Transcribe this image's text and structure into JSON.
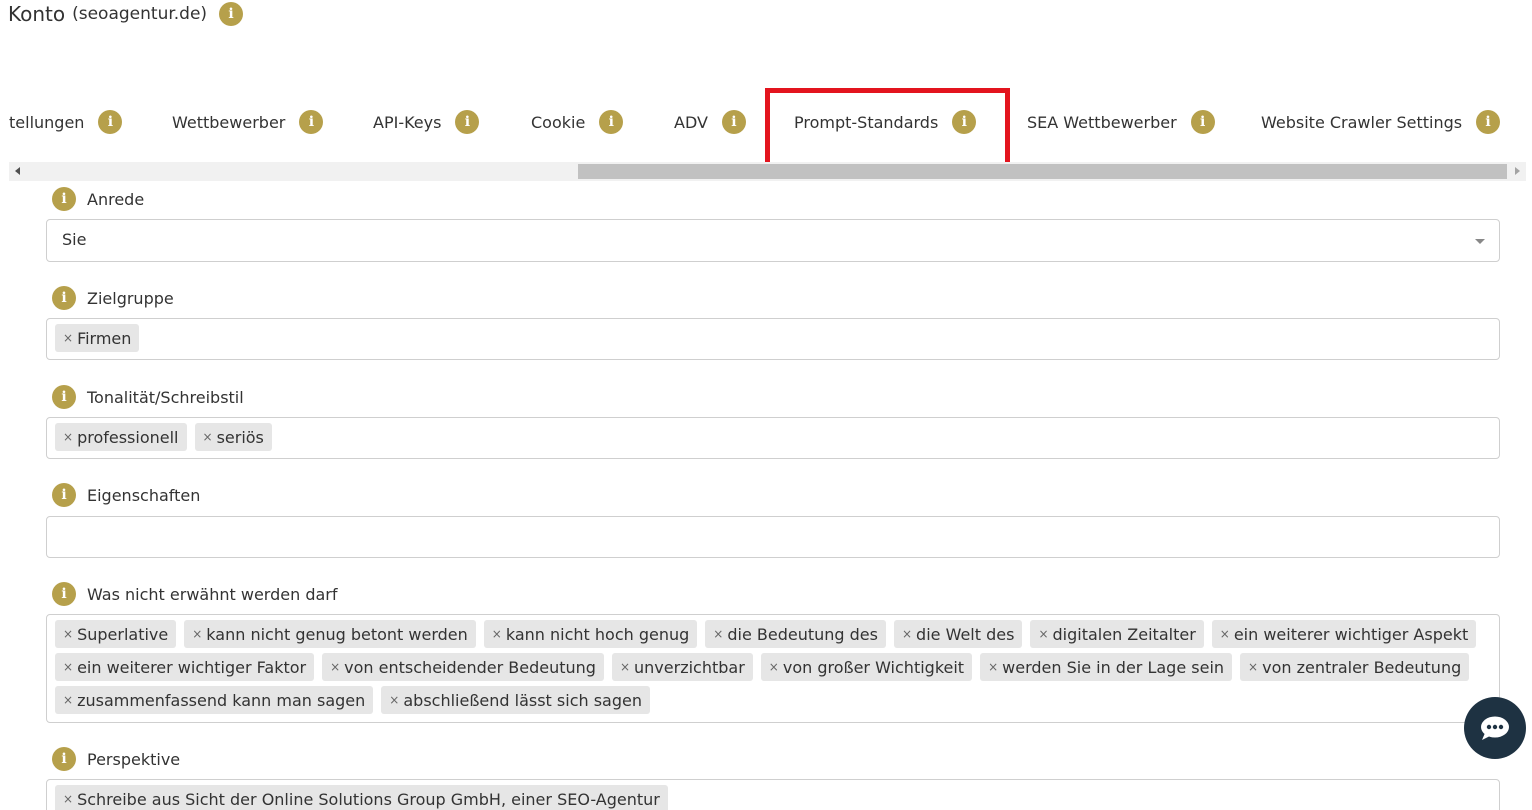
{
  "header": {
    "title": "Konto",
    "subtitle": "(seoagentur.de)",
    "info_icon": "i"
  },
  "tabs": [
    {
      "label": "tellungen",
      "icon": "i"
    },
    {
      "label": "Wettbewerber",
      "icon": "i"
    },
    {
      "label": "API-Keys",
      "icon": "i"
    },
    {
      "label": "Cookie",
      "icon": "i"
    },
    {
      "label": "ADV",
      "icon": "i"
    },
    {
      "label": "Prompt-Standards",
      "icon": "i"
    },
    {
      "label": "SEA Wettbewerber",
      "icon": "i"
    },
    {
      "label": "Website Crawler Settings",
      "icon": "i"
    }
  ],
  "form": {
    "anrede": {
      "label": "Anrede",
      "value": "Sie"
    },
    "zielgruppe": {
      "label": "Zielgruppe",
      "tags": [
        "Firmen"
      ]
    },
    "tonalitaet": {
      "label": "Tonalität/Schreibstil",
      "tags": [
        "professionell",
        "seriös"
      ]
    },
    "eigenschaften": {
      "label": "Eigenschaften",
      "tags": []
    },
    "nicht_erwaehnen": {
      "label": "Was nicht erwähnt werden darf",
      "tags": [
        "Superlative",
        "kann nicht genug betont werden",
        "kann nicht hoch genug",
        "die Bedeutung des",
        "die Welt des",
        "digitalen Zeitalter",
        "ein weiterer wichtiger Aspekt",
        "ein weiterer wichtiger Faktor",
        "von entscheidender Bedeutung",
        "unverzichtbar",
        "von großer Wichtigkeit",
        "werden Sie in der Lage sein",
        "von zentraler Bedeutung",
        "zusammenfassend kann man sagen",
        "abschließend lässt sich sagen"
      ]
    },
    "perspektive": {
      "label": "Perspektive",
      "tags": [
        "Schreibe aus Sicht der Online Solutions Group GmbH, einer SEO-Agentur"
      ]
    }
  },
  "tag_remove": "×",
  "icons": {
    "info": "info-icon",
    "chat": "chat-bubble-icon"
  },
  "colors": {
    "accent": "#b6a04b",
    "highlight": "#e3141e",
    "chat_bg": "#1e3242"
  }
}
